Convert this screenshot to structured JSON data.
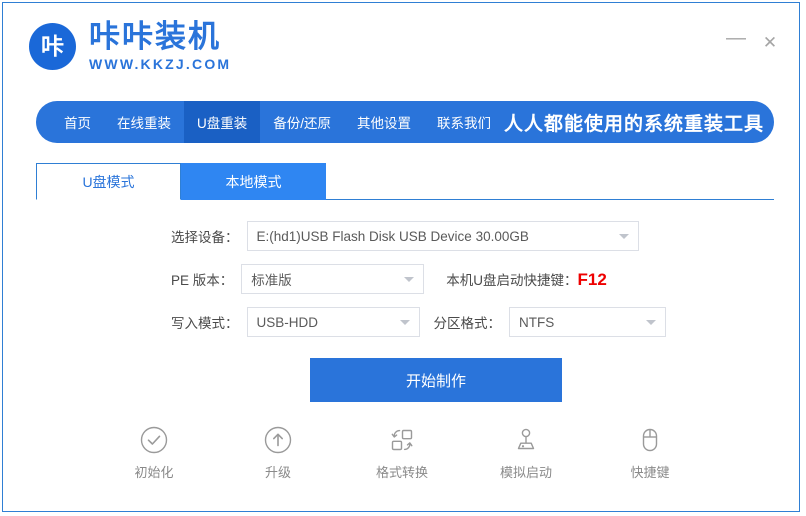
{
  "window": {
    "logo_mark": "咔",
    "logo_title": "咔咔装机",
    "logo_subtitle": "WWW.KKZJ.COM",
    "minimize_label": "—",
    "close_label": "✕",
    "accent_color": "#2a74da",
    "border_color": "#2f7fd4"
  },
  "nav": {
    "items": [
      {
        "label": "首页",
        "active": false
      },
      {
        "label": "在线重装",
        "active": false
      },
      {
        "label": "U盘重装",
        "active": true
      },
      {
        "label": "备份/还原",
        "active": false
      },
      {
        "label": "其他设置",
        "active": false
      },
      {
        "label": "联系我们",
        "active": false
      }
    ],
    "slogan": "人人都能使用的系统重装工具"
  },
  "tabs": [
    {
      "label": "U盘模式",
      "active": true
    },
    {
      "label": "本地模式",
      "active": false
    }
  ],
  "form": {
    "device": {
      "label": "选择设备：",
      "value": "E:(hd1)USB Flash Disk USB Device 30.00GB"
    },
    "pe_version": {
      "label": "PE 版本：",
      "value": "标准版"
    },
    "hotkey": {
      "label": "本机U盘启动快捷键：",
      "key": "F12",
      "key_color": "#ee0000"
    },
    "write_mode": {
      "label": "写入模式：",
      "value": "USB-HDD"
    },
    "partition_format": {
      "label": "分区格式：",
      "value": "NTFS"
    }
  },
  "primary_button": {
    "label": "开始制作"
  },
  "tools": [
    {
      "label": "初始化",
      "icon": "check-circle-icon"
    },
    {
      "label": "升级",
      "icon": "arrow-up-circle-icon"
    },
    {
      "label": "格式转换",
      "icon": "format-convert-icon"
    },
    {
      "label": "模拟启动",
      "icon": "joystick-icon"
    },
    {
      "label": "快捷键",
      "icon": "mouse-icon"
    }
  ]
}
